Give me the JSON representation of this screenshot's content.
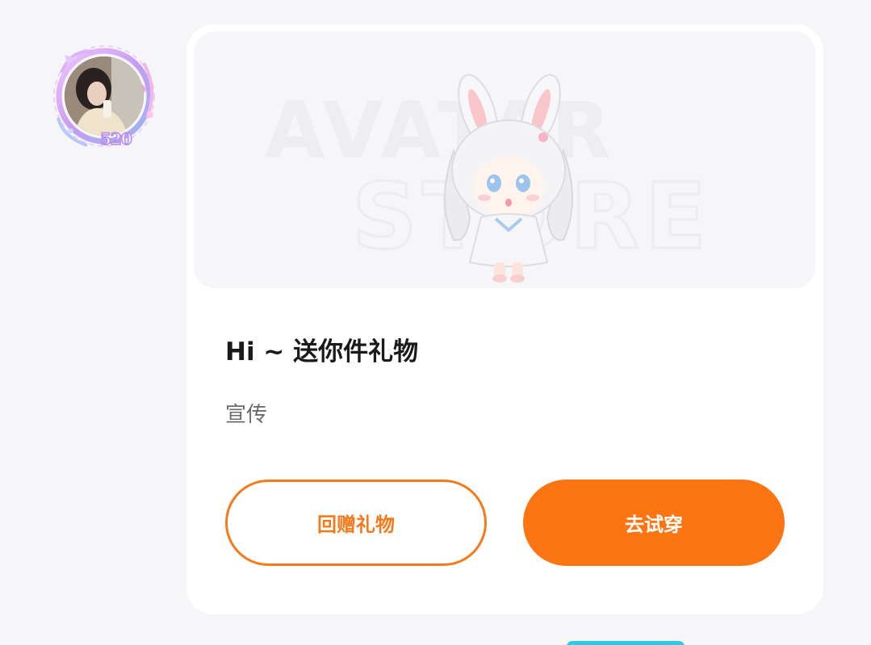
{
  "avatar": {
    "badge_text": "520",
    "frame_color": "#c9a6f2"
  },
  "card": {
    "banner": {
      "watermark_line1": "AVATAR",
      "watermark_line2": "STORE",
      "character_icon": "bunny-girl-avatar-icon"
    },
    "title": "Hi ~ 送你件礼物",
    "subtitle": "宣传",
    "buttons": {
      "return_gift_label": "回赠礼物",
      "try_on_label": "去试穿"
    }
  },
  "colors": {
    "accent": "#fd7513",
    "outline": "#f57a1c",
    "background": "#f6f6f8",
    "card": "#ffffff"
  }
}
